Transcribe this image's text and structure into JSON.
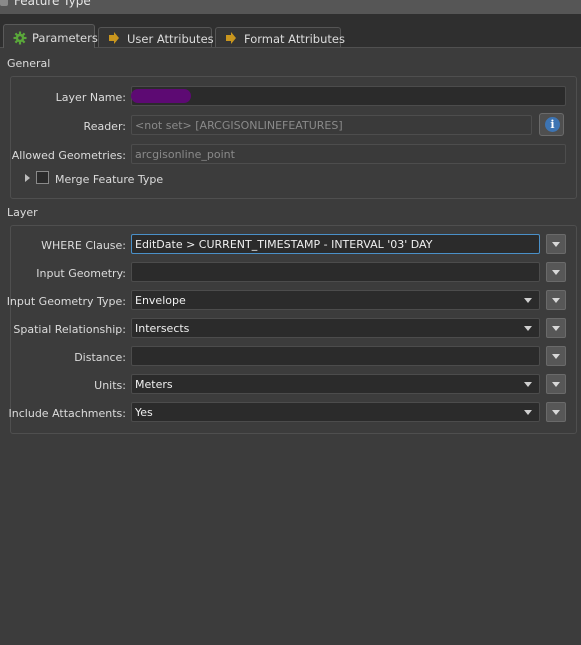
{
  "window": {
    "title": "Feature Type"
  },
  "tabs": [
    {
      "label": "Parameters",
      "icon": "gear-icon"
    },
    {
      "label": "User Attributes",
      "icon": "arrow-icon"
    },
    {
      "label": "Format Attributes",
      "icon": "arrow-icon"
    }
  ],
  "general": {
    "header": "General",
    "layer_name": {
      "label": "Layer Name:",
      "value": ""
    },
    "reader": {
      "label": "Reader:",
      "value": "<not set> [ARCGISONLINEFEATURES]"
    },
    "allowed_geometries": {
      "label": "Allowed Geometries:",
      "value": "arcgisonline_point"
    },
    "merge_feature_type": {
      "label": "Merge Feature Type",
      "checked": false
    }
  },
  "layer": {
    "header": "Layer",
    "where_clause": {
      "label": "WHERE Clause:",
      "value": "EditDate > CURRENT_TIMESTAMP - INTERVAL '03' DAY"
    },
    "input_geometry": {
      "label": "Input Geometry:",
      "value": ""
    },
    "input_geometry_type": {
      "label": "Input Geometry Type:",
      "value": "Envelope"
    },
    "spatial_relationship": {
      "label": "Spatial Relationship:",
      "value": "Intersects"
    },
    "distance": {
      "label": "Distance:",
      "value": ""
    },
    "units": {
      "label": "Units:",
      "value": "Meters"
    },
    "include_attachments": {
      "label": "Include Attachments:",
      "value": "Yes"
    }
  },
  "colors": {
    "accent": "#4a90c8",
    "background": "#3c3c3c",
    "field": "#2b2b2b",
    "redaction": "#5d0a73"
  }
}
